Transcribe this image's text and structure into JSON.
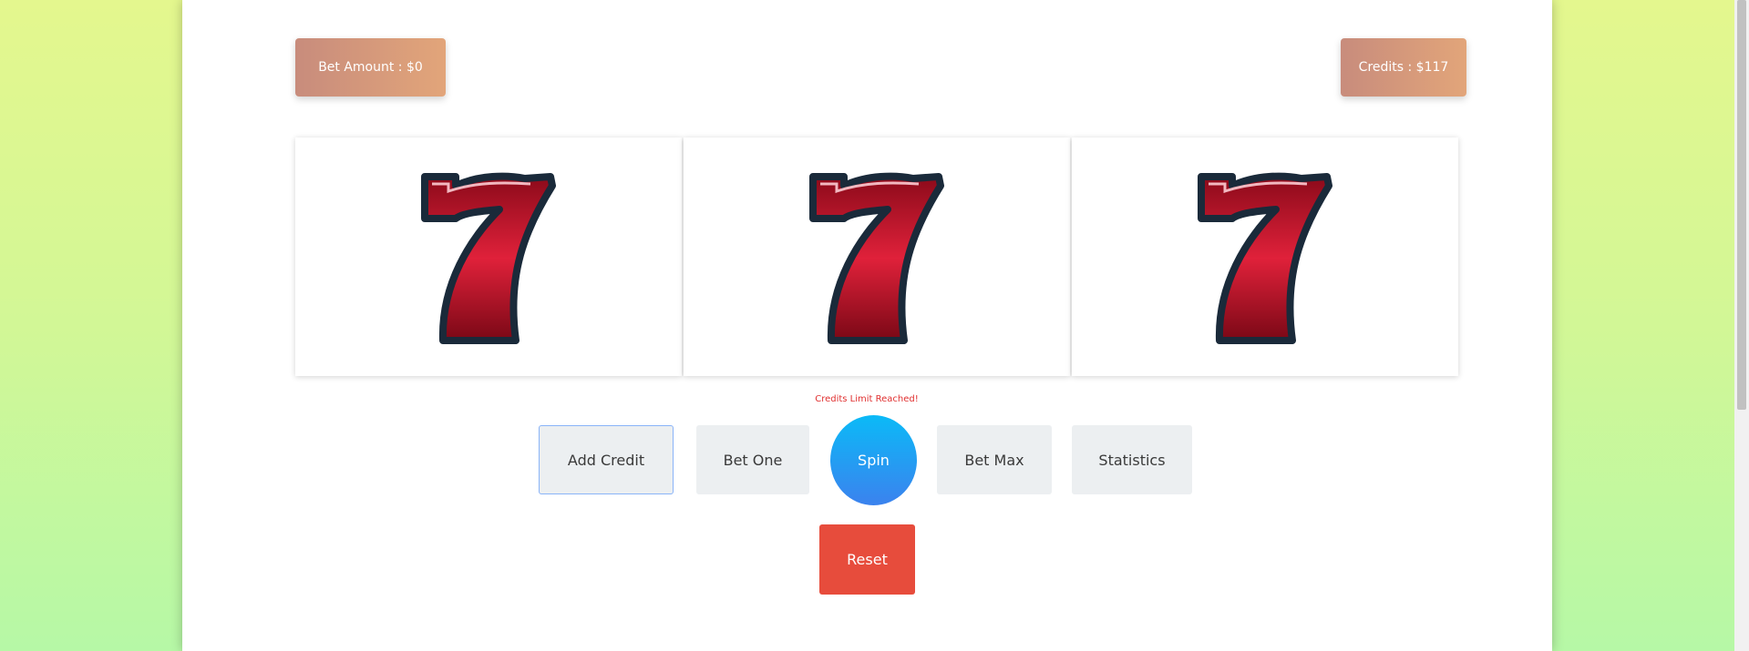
{
  "header": {
    "bet_amount": "Bet Amount : $0",
    "credits": "Credits : $117"
  },
  "reels": [
    {
      "symbol": "seven-icon"
    },
    {
      "symbol": "seven-icon"
    },
    {
      "symbol": "seven-icon"
    }
  ],
  "message": "Credits Limit Reached!",
  "controls": {
    "add_credit": "Add Credit",
    "bet_one": "Bet One",
    "spin": "Spin",
    "bet_max": "Bet Max",
    "statistics": "Statistics",
    "reset": "Reset"
  },
  "colors": {
    "seven_red": "#c8102e",
    "seven_outline": "#1a2a3a",
    "spin_top": "#0bbaf7",
    "spin_bottom": "#3b82ee",
    "reset": "#e74c3c",
    "pill_left": "#c88c7c",
    "pill_right": "#e2a57a",
    "message": "#e03030"
  }
}
